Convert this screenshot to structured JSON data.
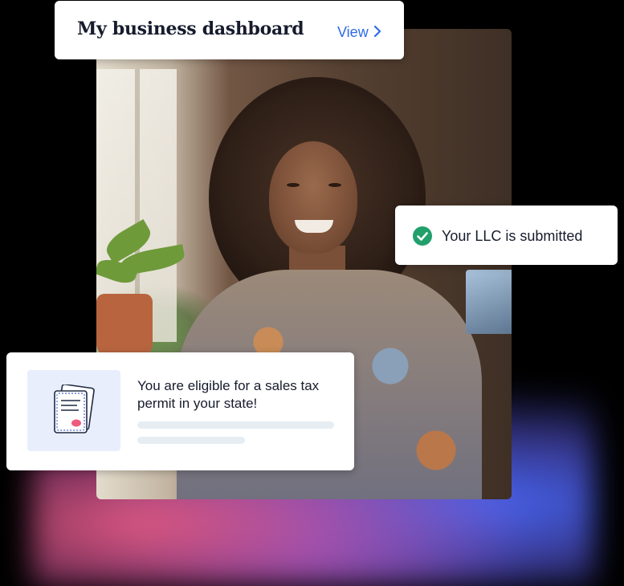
{
  "dashboard_card": {
    "title": "My business dashboard",
    "view_label": "View",
    "view_icon": "chevron-right-icon",
    "accent_color": "#2e6be6"
  },
  "llc_card": {
    "status_text": "Your LLC is submitted",
    "status_icon": "check-circle-icon",
    "status_color": "#22a06b"
  },
  "permit_card": {
    "message": "You are eligible for a sales tax permit in your state!",
    "illustration_icon": "certificate-icon"
  }
}
